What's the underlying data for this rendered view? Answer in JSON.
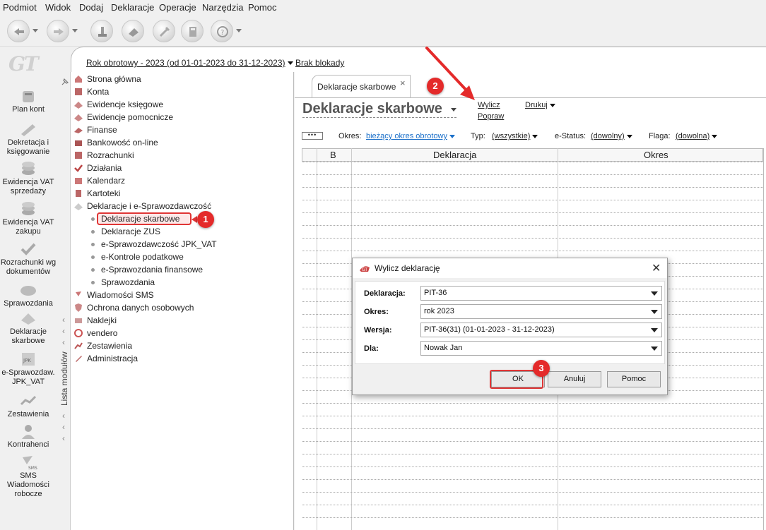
{
  "menu": [
    "Podmiot",
    "Widok",
    "Dodaj",
    "Deklaracje",
    "Operacje",
    "Narzędzia",
    "Pomoc"
  ],
  "brand_logo": "GT",
  "nav": [
    {
      "label": "Plan kont",
      "icon": "coins-icon"
    },
    {
      "label": "Dekretacja i księgowanie",
      "icon": "pencil-icon"
    },
    {
      "label": "Ewidencja VAT sprzedaży",
      "icon": "coins-stack-icon"
    },
    {
      "label": "Ewidencja VAT zakupu",
      "icon": "coins-stack-icon"
    },
    {
      "label": "Rozrachunki wg dokumentów",
      "icon": "check-icon"
    },
    {
      "label": "Sprawozdania",
      "icon": "report-icon"
    },
    {
      "label": "Deklaracje skarbowe",
      "icon": "declaration-icon"
    },
    {
      "label": "e-Sprawozdaw. JPK_VAT",
      "icon": "jpk-icon"
    },
    {
      "label": "Zestawienia",
      "icon": "chart-icon"
    },
    {
      "label": "Kontrahenci",
      "icon": "person-icon"
    },
    {
      "label": "SMS Wiadomości robocze",
      "icon": "sms-icon"
    }
  ],
  "header": {
    "fiscal_year": "Rok obrotowy - 2023  (od 01-01-2023 do 31-12-2023)",
    "lock": "Brak blokady"
  },
  "module_list_label": "Lista modułów",
  "tree": [
    "Strona główna",
    "Konta",
    "Ewidencje księgowe",
    "Ewidencje pomocnicze",
    "Finanse",
    "Bankowość on-line",
    "Rozrachunki",
    "Działania",
    "Kalendarz",
    "Kartoteki",
    "Deklaracje i e-Sprawozdawczość"
  ],
  "subtree": [
    "Deklaracje skarbowe",
    "Deklaracje ZUS",
    "e-Sprawozdawczość JPK_VAT",
    "e-Kontrole podatkowe",
    "e-Sprawozdania finansowe",
    "Sprawozdania"
  ],
  "tree2": [
    "Wiadomości SMS",
    "Ochrona danych osobowych",
    "Naklejki",
    "vendero",
    "Zestawienia",
    "Administracja"
  ],
  "tab": {
    "label": "Deklaracje skarbowe",
    "close": "×"
  },
  "page": {
    "title": "Deklaracje skarbowe",
    "calc": "Wylicz",
    "fix": "Popraw",
    "print": "Drukuj"
  },
  "filters": {
    "dots": "•••",
    "okres_label": "Okres:",
    "okres_value": "bieżący okres obrotowy",
    "typ_label": "Typ:",
    "typ_value": "(wszystkie)",
    "estatus_label": "e-Status:",
    "estatus_value": "(dowolny)",
    "flaga_label": "Flaga:",
    "flaga_value": "(dowolna)"
  },
  "grid": {
    "columns": [
      "B",
      "Deklaracja",
      "Okres"
    ]
  },
  "dialog": {
    "title": "Wylicz deklarację",
    "close": "✕",
    "fields": [
      {
        "label": "Deklaracja:",
        "value": "PIT-36"
      },
      {
        "label": "Okres:",
        "value": "rok 2023"
      },
      {
        "label": "Wersja:",
        "value": "PIT-36(31) (01-01-2023 - 31-12-2023)"
      },
      {
        "label": "Dla:",
        "value": "Nowak Jan"
      }
    ],
    "ok": "OK",
    "cancel": "Anuluj",
    "help": "Pomoc"
  },
  "markers": [
    "1",
    "2",
    "3"
  ],
  "colors": {
    "accent_red": "#e42a2a",
    "link_blue": "#1a6fc9"
  }
}
